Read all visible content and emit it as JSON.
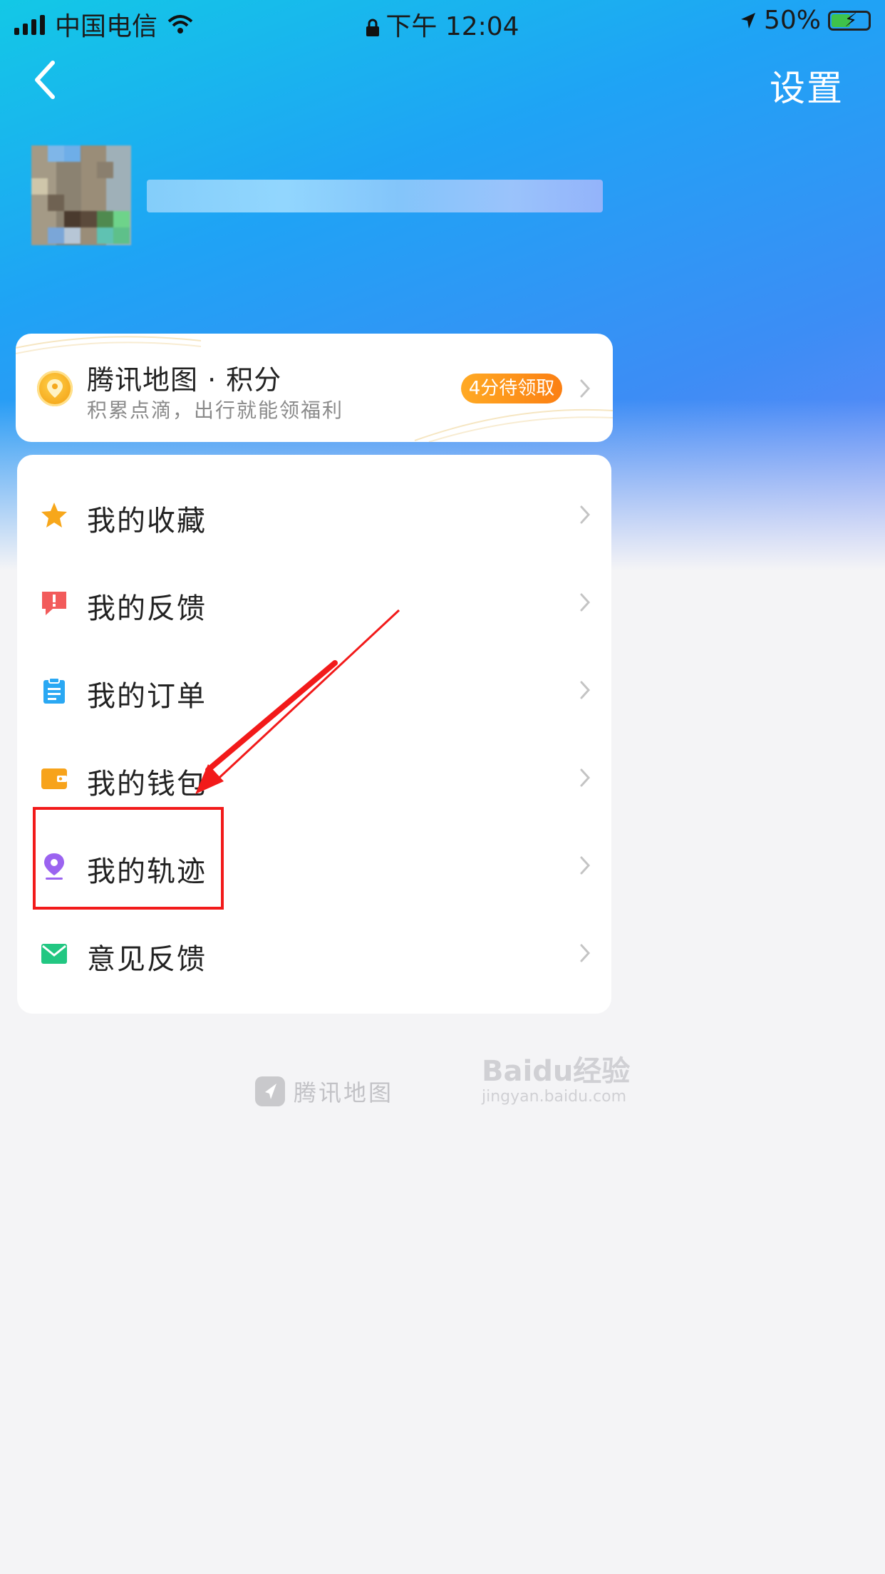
{
  "status_bar": {
    "carrier": "中国电信",
    "time": "下午 12:04",
    "battery_percent": "50%"
  },
  "header": {
    "settings_label": "设置"
  },
  "points_card": {
    "title": "腾讯地图 · 积分",
    "subtitle": "积累点滴，出行就能领福利",
    "badge": "4分待领取"
  },
  "menu": {
    "items": [
      {
        "label": "我的收藏",
        "icon": "star-icon",
        "color": "#f7a71b"
      },
      {
        "label": "我的反馈",
        "icon": "feedback-alert-icon",
        "color": "#f25b5b"
      },
      {
        "label": "我的订单",
        "icon": "order-clipboard-icon",
        "color": "#2aa8f3"
      },
      {
        "label": "我的钱包",
        "icon": "wallet-icon",
        "color": "#f7a31b"
      },
      {
        "label": "我的轨迹",
        "icon": "location-pin-icon",
        "color": "#9b63f0"
      },
      {
        "label": "意见反馈",
        "icon": "mail-icon",
        "color": "#22c782"
      }
    ]
  },
  "annotation": {
    "highlight_color": "#f21a1a"
  },
  "footer": {
    "brand": "腾讯地图",
    "watermark": "Baidu经验",
    "watermark_sub": "jingyan.baidu.com"
  }
}
